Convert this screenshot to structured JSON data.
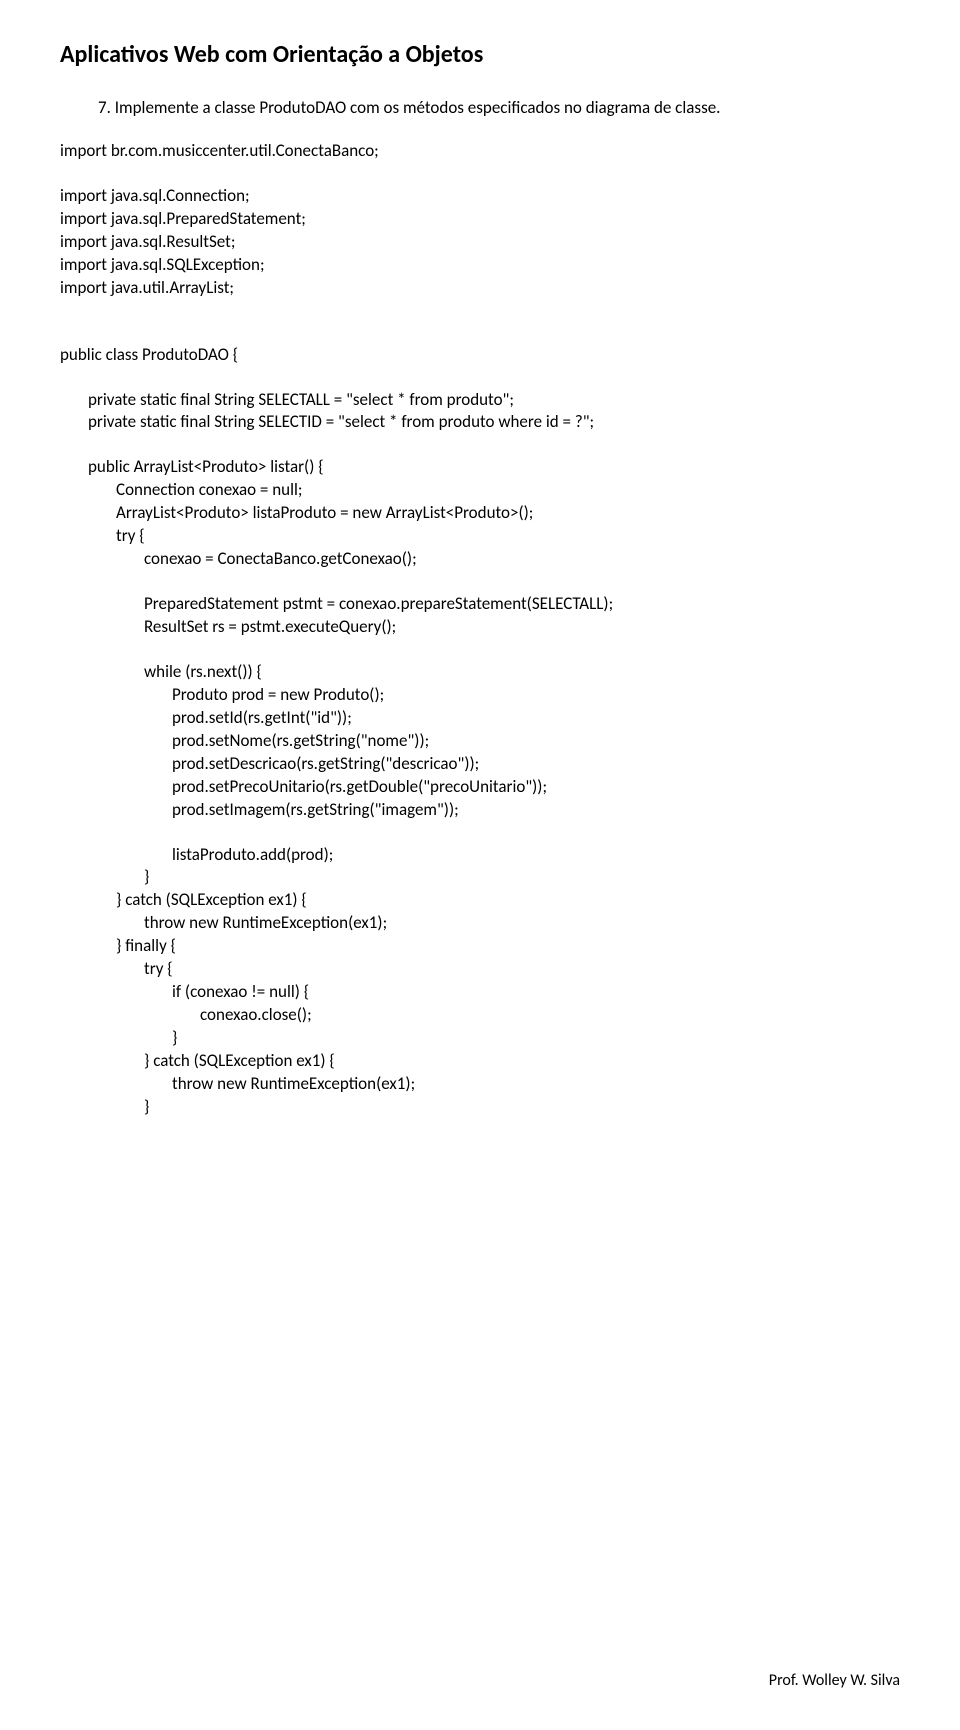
{
  "title": "Aplicativos Web com Orientação a Objetos",
  "exercise": "7. Implemente a classe ProdutoDAO com os métodos especificados no diagrama de classe.",
  "code": {
    "import1": "import br.com.musiccenter.util.ConectaBanco;",
    "import2": "import java.sql.Connection;",
    "import3": "import java.sql.PreparedStatement;",
    "import4": "import java.sql.ResultSet;",
    "import5": "import java.sql.SQLException;",
    "import6": "import java.util.ArrayList;",
    "classDecl": "public class ProdutoDAO {",
    "field1": "private static final String SELECTALL = \"select * from produto\";",
    "field2": "private static final String SELECTID = \"select * from produto where id = ?\";",
    "method1": "public ArrayList<Produto> listar() {",
    "m1l1": "Connection conexao = null;",
    "m1l2": "ArrayList<Produto> listaProduto = new ArrayList<Produto>();",
    "m1l3": "try {",
    "m1l4": "conexao = ConectaBanco.getConexao();",
    "m1l5": "PreparedStatement pstmt = conexao.prepareStatement(SELECTALL);",
    "m1l6": "ResultSet rs = pstmt.executeQuery();",
    "m1l7": "while (rs.next()) {",
    "m1l8": "Produto prod = new Produto();",
    "m1l9": "prod.setId(rs.getInt(\"id\"));",
    "m1l10": "prod.setNome(rs.getString(\"nome\"));",
    "m1l11": "prod.setDescricao(rs.getString(\"descricao\"));",
    "m1l12": "prod.setPrecoUnitario(rs.getDouble(\"precoUnitario\"));",
    "m1l13": "prod.setImagem(rs.getString(\"imagem\"));",
    "m1l14": "listaProduto.add(prod);",
    "m1l15": "}",
    "m1l16": "} catch (SQLException ex1) {",
    "m1l17": "throw new RuntimeException(ex1);",
    "m1l18": "} finally {",
    "m1l19": "try {",
    "m1l20": "if (conexao != null) {",
    "m1l21": "conexao.close();",
    "m1l22": "}",
    "m1l23": "} catch (SQLException ex1) {",
    "m1l24": "throw new RuntimeException(ex1);",
    "m1l25": "}"
  },
  "footer": "Prof. Wolley W. Silva"
}
